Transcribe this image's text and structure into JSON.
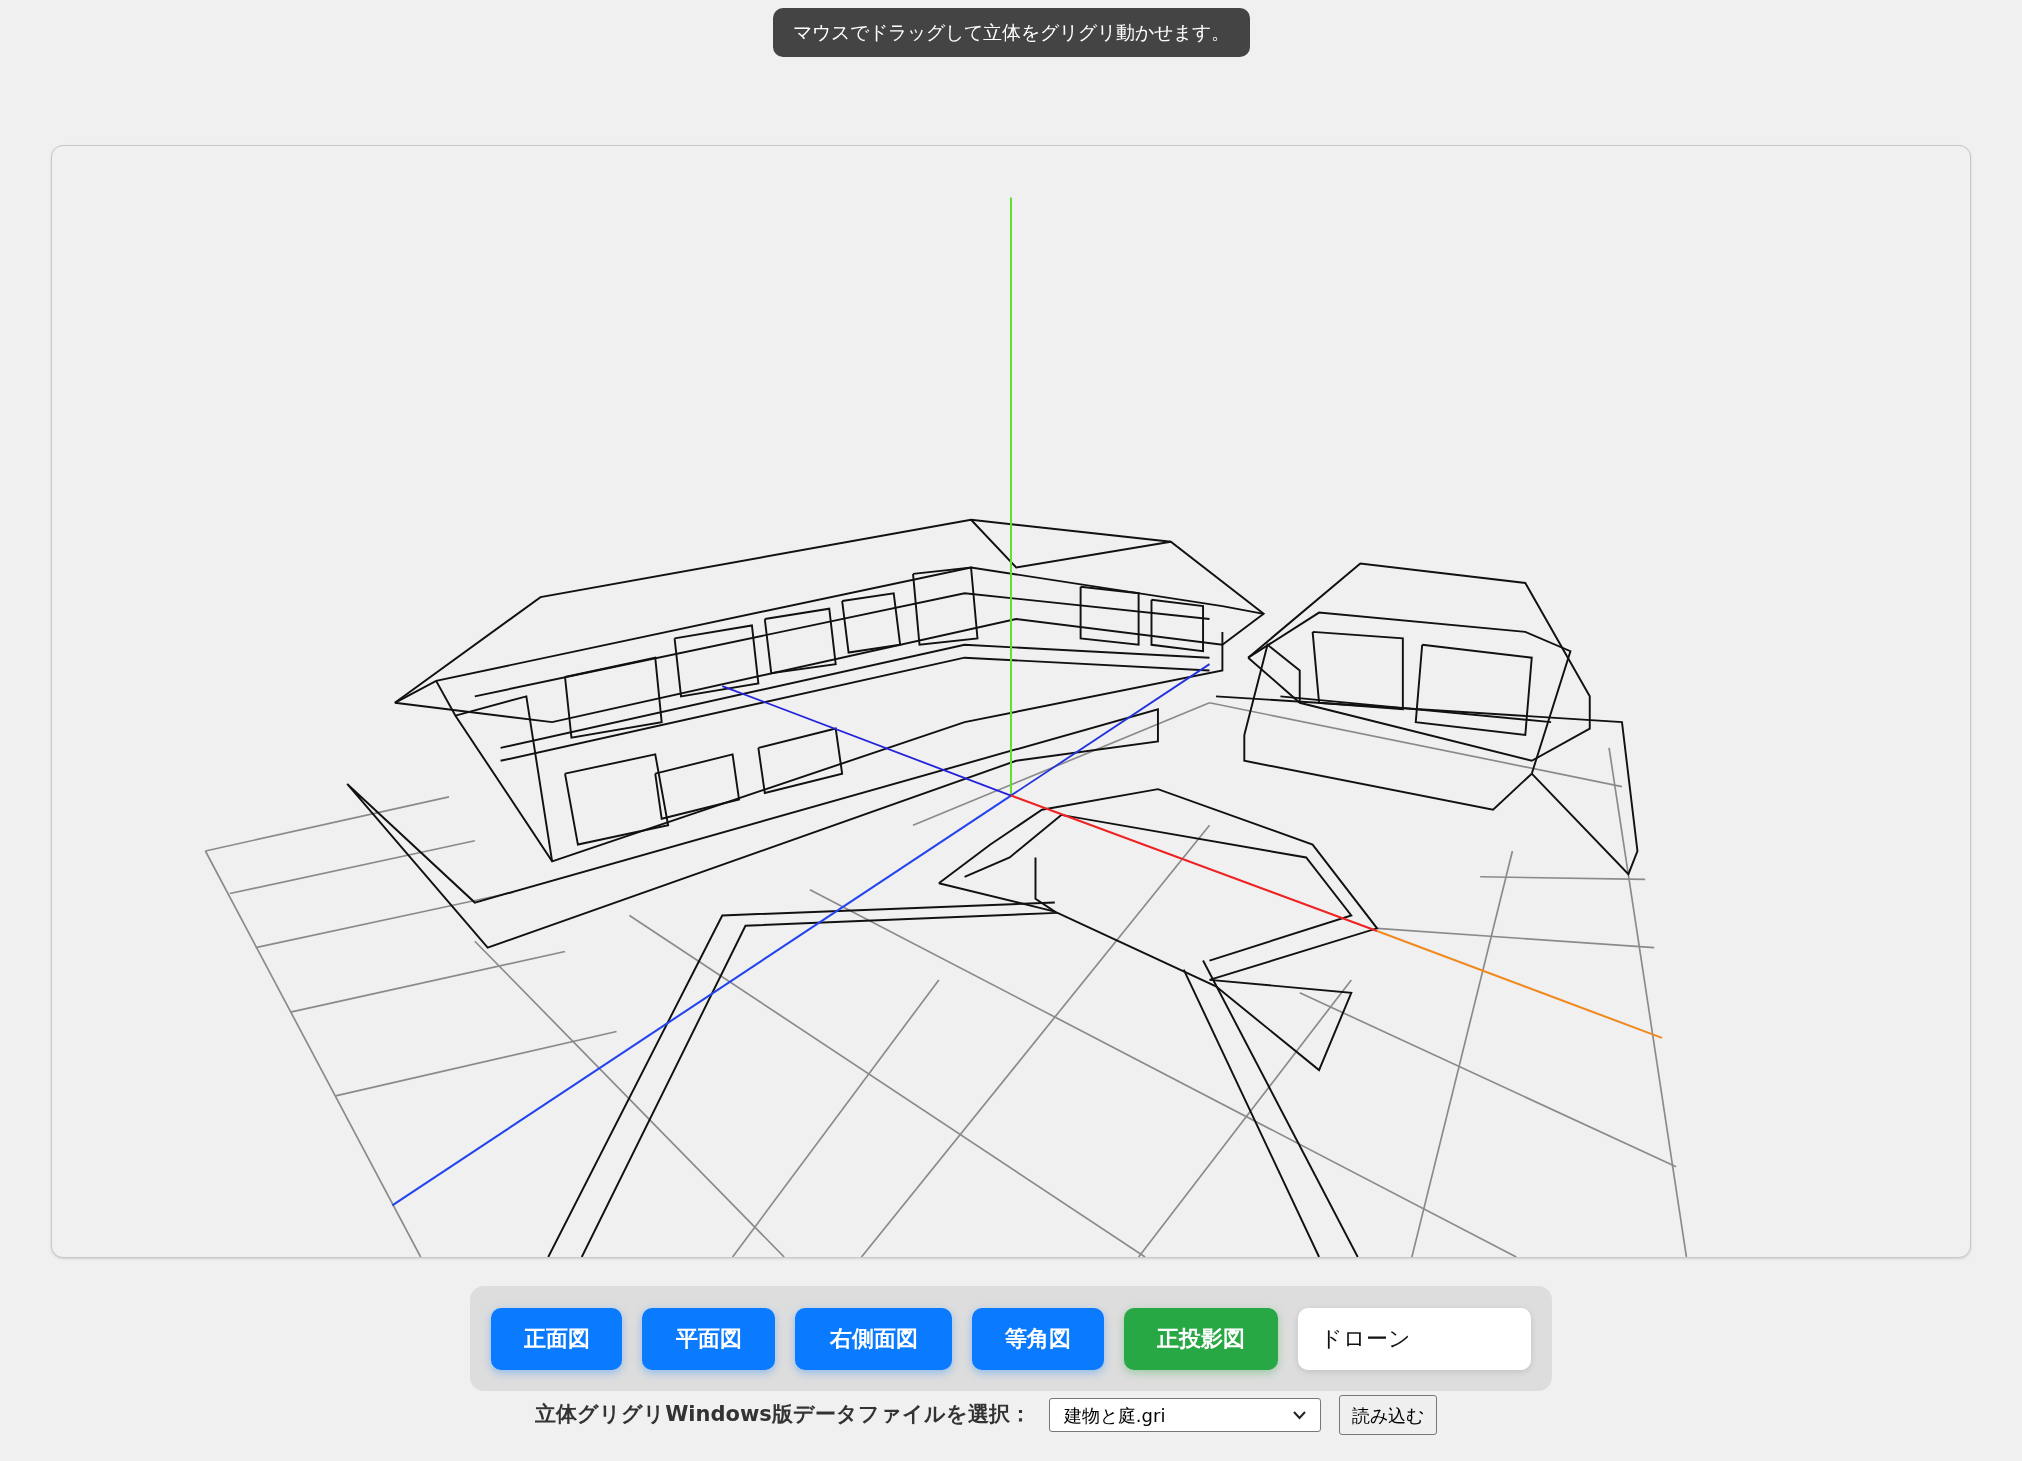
{
  "hint": "マウスでドラッグして立体をグリグリ動かせます。",
  "toolbar": {
    "buttons": [
      {
        "label": "正面図",
        "kind": "view"
      },
      {
        "label": "平面図",
        "kind": "view"
      },
      {
        "label": "右側面図",
        "kind": "view"
      },
      {
        "label": "等角図",
        "kind": "view"
      },
      {
        "label": "正投影図",
        "kind": "toggle",
        "on": true
      },
      {
        "label": "ドローン",
        "kind": "toggle",
        "on": false
      }
    ]
  },
  "file_picker": {
    "label": "立体グリグリWindows版データファイルを選択：",
    "value": "建物と庭.gri",
    "load_button": "読み込む"
  }
}
